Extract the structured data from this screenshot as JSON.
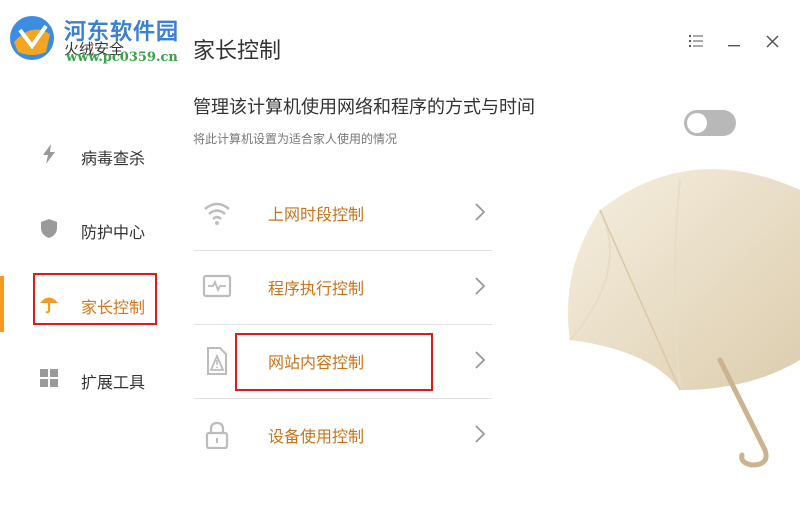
{
  "watermark": {
    "site_name": "河东软件园",
    "url": "www.pc0359.cn"
  },
  "app": {
    "name": "火绒安全",
    "page_title": "家长控制"
  },
  "window_controls": [
    "menu-icon",
    "minimize-icon",
    "close-icon"
  ],
  "sidebar": {
    "items": [
      {
        "label": "病毒查杀",
        "icon": "lightning-icon",
        "active": false
      },
      {
        "label": "防护中心",
        "icon": "shield-icon",
        "active": false
      },
      {
        "label": "家长控制",
        "icon": "umbrella-icon",
        "active": true
      },
      {
        "label": "扩展工具",
        "icon": "grid-icon",
        "active": false
      }
    ]
  },
  "header": {
    "headline": "管理该计算机使用网络和程序的方式与时间",
    "subline": "将此计算机设置为适合家人使用的情况"
  },
  "toggle": {
    "state": "off"
  },
  "options": [
    {
      "label": "上网时段控制",
      "icon": "wifi-icon"
    },
    {
      "label": "程序执行控制",
      "icon": "monitor-icon"
    },
    {
      "label": "网站内容控制",
      "icon": "document-warning-icon"
    },
    {
      "label": "设备使用控制",
      "icon": "lock-icon"
    }
  ],
  "colors": {
    "accent": "#d4781b",
    "active_bar": "#f29b1f",
    "highlight_box": "#e01919",
    "watermark_blue": "#3a7fd0",
    "watermark_green": "#3aa24a"
  }
}
